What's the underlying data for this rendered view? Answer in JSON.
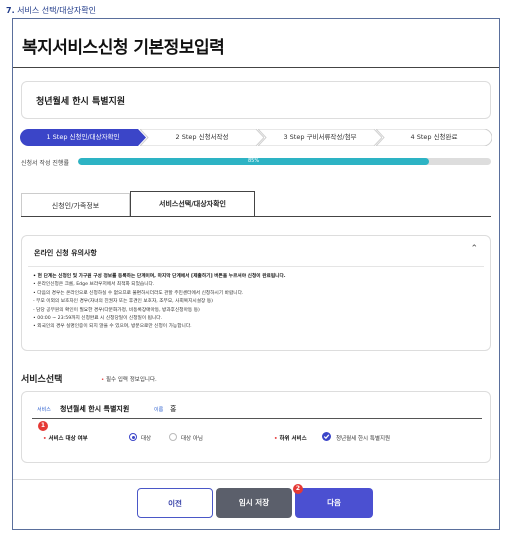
{
  "caption": {
    "number": "7.",
    "text": "서비스 선택/대상자확인"
  },
  "page_title": "복지서비스신청 기본정보입력",
  "service_card": "청년월세 한시 특별지원",
  "steps": [
    {
      "label": "1 Step 신청인/대상자확인",
      "active": true
    },
    {
      "label": "2 Step 신청서작성",
      "active": false
    },
    {
      "label": "3 Step 구비서류작성/첨부",
      "active": false
    },
    {
      "label": "4 Step 신청완료",
      "active": false
    }
  ],
  "progress": {
    "label": "신청서 작성 진행률",
    "value": 85,
    "text": "85%"
  },
  "tabs": [
    {
      "label": "신청인/가족정보",
      "active": false
    },
    {
      "label": "서비스선택/대상자확인",
      "active": true
    }
  ],
  "notice": {
    "title": "온라인 신청 유의사항",
    "items": [
      {
        "text": "• 현 단계는 신청인 및 가구원 구성 정보를 등록하는 단계이며, 마지막 단계에서 [제출하기] 버튼을 누르셔야 신청이 완료됩니다.",
        "bold": true
      },
      {
        "text": "• 온라인신청은 크롬, Edge 브라우저에서 최적화 되었습니다.",
        "bold": false
      },
      {
        "text": "• 다음의 경우는 온라인으로 신청하실 수 없으므로 불편하시더라도 관할 주민센터에서 신청하시기 바랍니다.",
        "bold": false
      },
      {
        "text": "  - 부모 이외의 보호자인 경우(자녀의 친권자 또는 후견인 보호자, 조부모, 사회복지시설장 등)",
        "bold": false
      },
      {
        "text": "  - 담당 공무원의 확인이 필요한 경우(다문화가정, 비동록장애아동, 방과후신청아동 등)",
        "bold": false
      },
      {
        "text": "• 00:00 ~ 23:59까지 신청완료 시 신청당일이 신청일이 됩니다.",
        "bold": false
      },
      {
        "text": "• 외국인의 경우 실명인증이 되지 않을 수 있으며, 방문으로만 신청이 가능합니다.",
        "bold": false
      }
    ]
  },
  "service_select": {
    "title": "서비스선택",
    "required_note": "필수 입력 정보입니다.",
    "service_key": "서비스",
    "service_value": "청년월세 한시 특별지원",
    "name_key": "이름",
    "name_value": "홍",
    "target_label": "서비스 대상 여부",
    "options": [
      "대상",
      "대상 아님"
    ],
    "selected_option": "대상",
    "sub_service_label": "하위 서비스",
    "sub_service_value": "청년월세 한시 특별지원"
  },
  "badges": [
    "1",
    "2"
  ],
  "buttons": {
    "prev": "이전",
    "save": "임시 저장",
    "next": "다음"
  },
  "colors": {
    "accent": "#4b50d1",
    "step_active": "#3b45c8",
    "progress": "#2db3c4",
    "required": "#e63b3b",
    "badge": "#e53935"
  }
}
